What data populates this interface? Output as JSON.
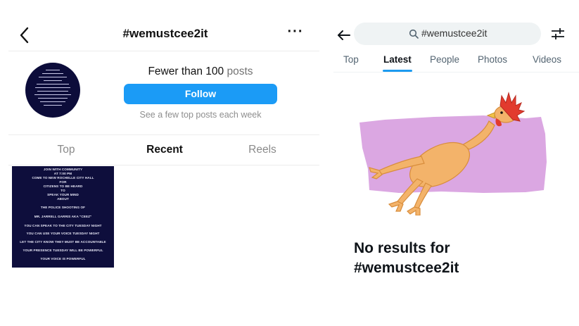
{
  "instagram": {
    "header": {
      "title": "#wemustcee2it"
    },
    "count_number": "Fewer than 100",
    "count_label": "posts",
    "follow_label": "Follow",
    "follow_sub": "See a few top posts each week",
    "tabs": [
      {
        "label": "Top",
        "active": false
      },
      {
        "label": "Recent",
        "active": true
      },
      {
        "label": "Reels",
        "active": false
      }
    ],
    "post": {
      "lines": [
        "JOIN WITH COMMUNITY",
        "AT 7:00 PM",
        "COME TO NEW ROCHELLE CITY HALL",
        "FOR",
        "CITIZENS TO BE HEARD",
        "TO",
        "SPEAK YOUR MIND",
        "ABOUT",
        "THE POLICE SHOOTING OF",
        "MR. JARRELL GARRIS AKA \"CEEZ\"",
        "YOU CAN SPEAK TO THE CITY TUESDAY NIGHT",
        "YOU CAN USE YOUR VOICE TUESDAY NIGHT",
        "LET THE CITY KNOW THEY MUST BE ACCOUNTABLE",
        "YOUR PRESENCE TUESDAY WILL BE POWERFUL",
        "YOUR VOICE IS POWERFUL"
      ]
    },
    "icons": {
      "back": "chevron-left-icon",
      "more": "more-horizontal-icon"
    }
  },
  "x": {
    "search_value": "#wemustcee2it",
    "tabs": [
      {
        "label": "Top",
        "active": false
      },
      {
        "label": "Latest",
        "active": true
      },
      {
        "label": "People",
        "active": false
      },
      {
        "label": "Photos",
        "active": false
      },
      {
        "label": "Videos",
        "active": false
      }
    ],
    "empty_title_line1": "No results for",
    "empty_title_line2": "#wemustcee2it",
    "icons": {
      "back": "arrow-left-icon",
      "search": "search-icon",
      "filter": "filter-sliders-icon",
      "illustration": "rubber-chicken-illustration"
    },
    "colors": {
      "accent": "#1d9bf0",
      "illustration_bg": "#dba7e2"
    }
  },
  "colors": {
    "follow_button": "#1b9bf6",
    "post_bg": "#0e0e3c"
  }
}
